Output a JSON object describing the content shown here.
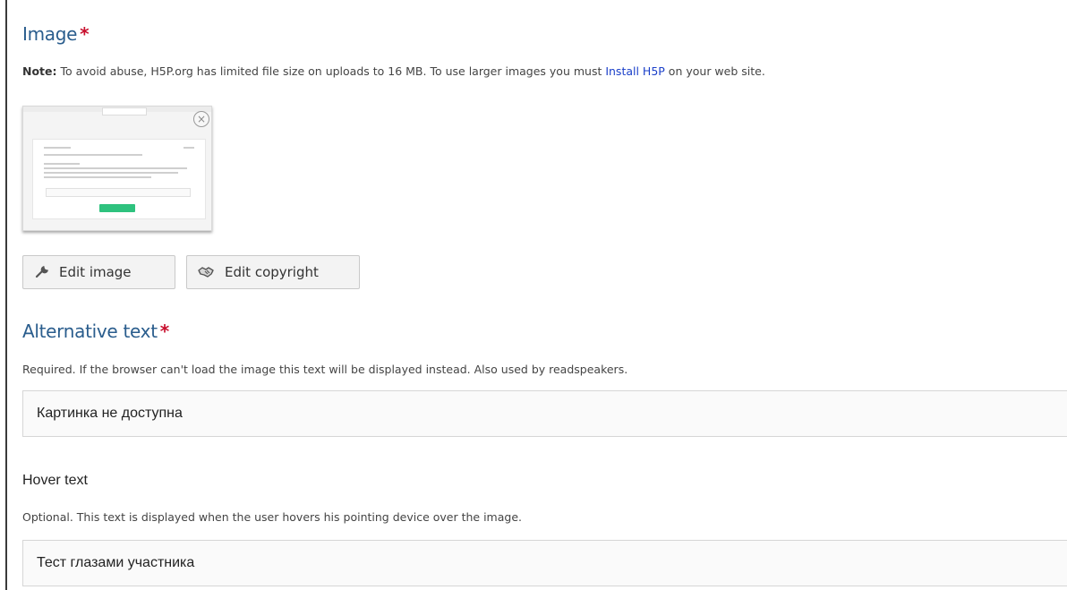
{
  "image_field": {
    "title": "Image",
    "required_mark": "*",
    "note_label": "Note:",
    "note_text": " To avoid abuse, H5P.org has limited file size on uploads to 16 MB. To use larger images you must ",
    "note_link": "Install H5P",
    "note_suffix": " on your web site.",
    "edit_image_label": "Edit image",
    "edit_copyright_label": "Edit copyright",
    "remove_icon": "close-icon"
  },
  "alt_text_field": {
    "title": "Alternative text",
    "required_mark": "*",
    "description": "Required. If the browser can't load the image this text will be displayed instead. Also used by readspeakers.",
    "value": "Картинка не доступна"
  },
  "hover_text_field": {
    "title": "Hover text",
    "description": "Optional. This text is displayed when the user hovers his pointing device over the image.",
    "value": "Тест глазами участника"
  },
  "colors": {
    "title": "#2a5d8d",
    "required": "#c8102e",
    "link": "#1a3fc9"
  }
}
